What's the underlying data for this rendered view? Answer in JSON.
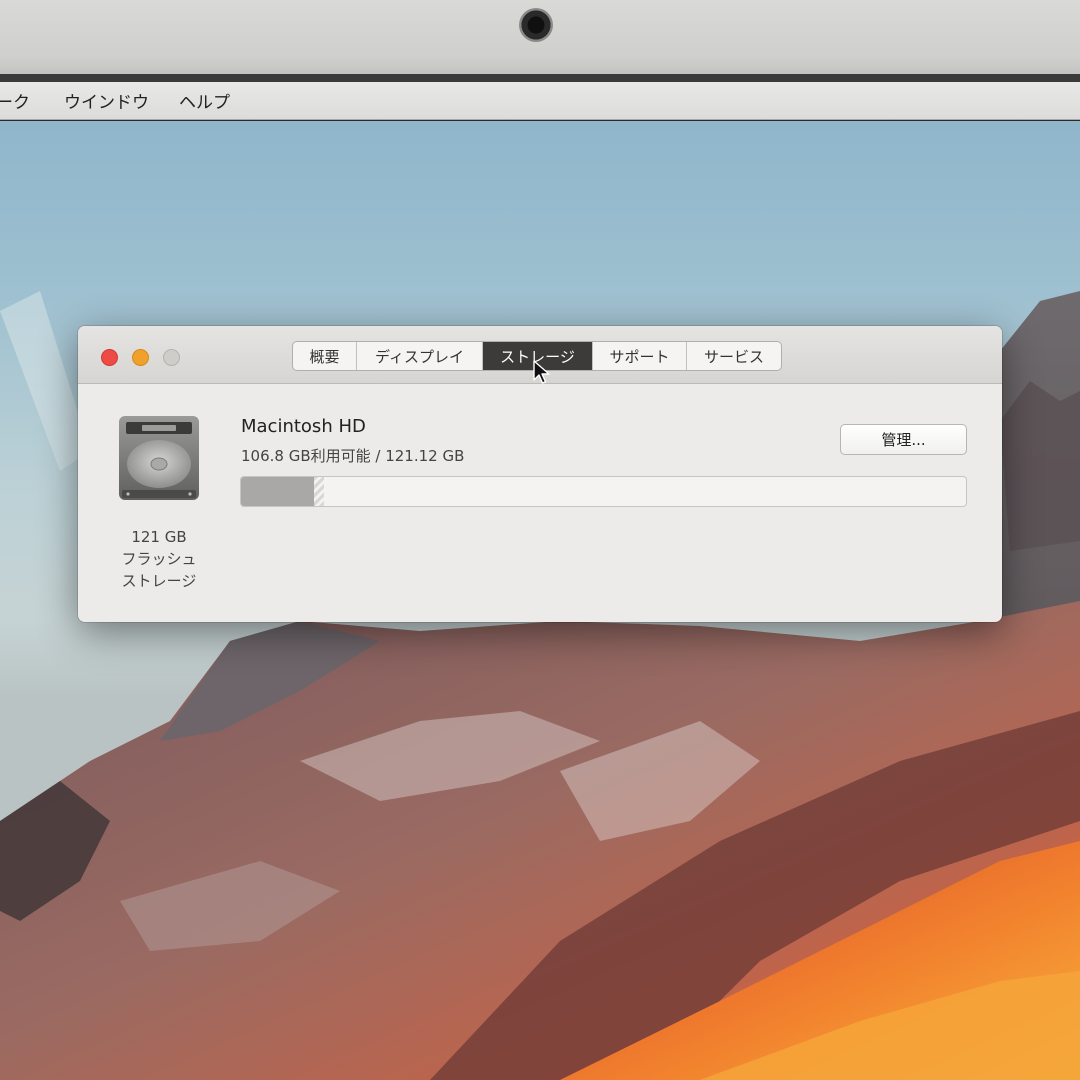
{
  "menubar": {
    "items": [
      "ーク",
      "ウインドウ",
      "ヘルプ"
    ]
  },
  "window": {
    "tabs": [
      {
        "label": "概要",
        "active": false
      },
      {
        "label": "ディスプレイ",
        "active": false
      },
      {
        "label": "ストレージ",
        "active": true
      },
      {
        "label": "サポート",
        "active": false
      },
      {
        "label": "サービス",
        "active": false
      }
    ],
    "volume": {
      "name": "Macintosh HD",
      "availability": "106.8 GB利用可能 / 121.12 GB",
      "manage_button": "管理...",
      "used_fraction": 0.1,
      "other_fraction": 0.015
    },
    "disk": {
      "icon": "hard-drive-icon",
      "capacity": "121 GB",
      "type_line1": "フラッシュ",
      "type_line2": "ストレージ"
    }
  },
  "colors": {
    "close": "#ee4b45",
    "minimize": "#f0a12c",
    "active_tab": "#3c3b3a"
  }
}
